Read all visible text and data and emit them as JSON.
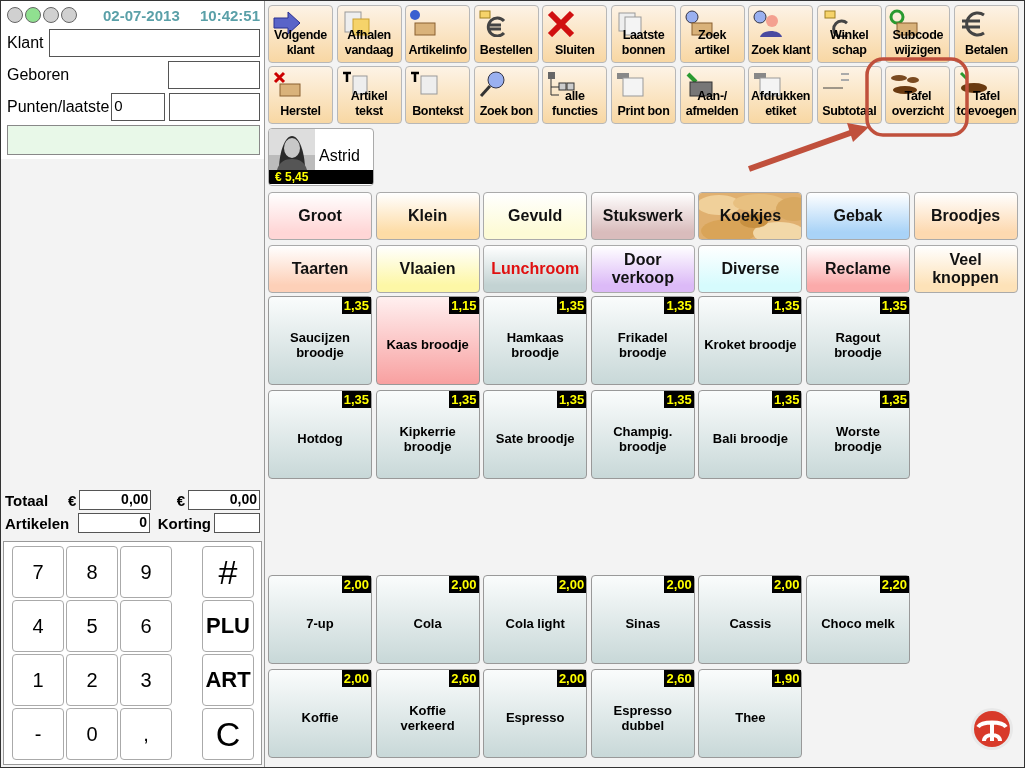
{
  "status": {
    "lights": [
      {
        "on": false
      },
      {
        "on": true
      },
      {
        "on": false
      },
      {
        "on": false
      }
    ],
    "date": "02-07-2013",
    "time": "10:42:51"
  },
  "customer": {
    "klant_label": "Klant",
    "geboren_label": "Geboren",
    "punten_label": "Punten/laatste",
    "punten_value": "0"
  },
  "totals": {
    "totaal_label": "Totaal",
    "currency_1": "€",
    "totaal_value": "0,00",
    "currency_2": "€",
    "second_value": "0,00",
    "artikelen_label": "Artikelen",
    "artikelen_value": "0",
    "korting_label": "Korting"
  },
  "numpad": [
    [
      "7",
      "8",
      "9",
      "#"
    ],
    [
      "4",
      "5",
      "6",
      "PLU"
    ],
    [
      "1",
      "2",
      "3",
      "ART"
    ],
    [
      "-",
      "0",
      ",",
      "C"
    ]
  ],
  "toolbar_rows": [
    [
      "Volgende klant",
      "Afhalen vandaag",
      "Artikelinfo",
      "Bestellen",
      "Sluiten",
      "Laatste bonnen",
      "Zoek artikel",
      "Zoek klant",
      "Winkel schap",
      "Subcode wijzigen",
      "Betalen"
    ],
    [
      "Herstel",
      "Artikel tekst",
      "Bontekst",
      "Zoek bon",
      "alle functies",
      "Print bon",
      "Aan-/ afmelden",
      "Afdrukken etiket",
      "Subtotaal",
      "Tafel overzicht",
      "Tafel toevoegen"
    ]
  ],
  "operator": {
    "name": "Astrid",
    "amount": "€ 5,45"
  },
  "categories": [
    [
      {
        "label": "Groot",
        "color": "#ffd6d6",
        "selected": false
      },
      {
        "label": "Klein",
        "color": "#fddca6",
        "selected": false
      },
      {
        "label": "Gevuld",
        "color": "#fdfbd6",
        "selected": false
      },
      {
        "label": "Stukswerk",
        "color": "#d9bcbc",
        "selected": false
      },
      {
        "label": "Koekjes",
        "kind": "picture",
        "color": "#e0b070",
        "selected": false
      },
      {
        "label": "Gebak",
        "color": "#a9d3f7",
        "selected": false
      },
      {
        "label": "Broodjes",
        "color": "#fdd9b0",
        "selected": false
      }
    ],
    [
      {
        "label": "Taarten",
        "color": "#fdd0b8",
        "selected": false
      },
      {
        "label": "Vlaaien",
        "color": "#fdf7a6",
        "selected": false
      },
      {
        "label": "Lunchroom",
        "color": "#c3d3d3",
        "selected": true
      },
      {
        "label": "Door verkoop",
        "color": "#dcbaf7",
        "selected": false
      },
      {
        "label": "Diverse",
        "color": "#d6fbfd",
        "selected": false
      },
      {
        "label": "Reclame",
        "color": "#fbaaaa",
        "selected": false
      },
      {
        "label": "Veel knoppen",
        "color": "#fde2b8",
        "selected": false
      }
    ]
  ],
  "food_products": [
    [
      {
        "name": "Saucijzen broodje",
        "price": "1,35",
        "highlighted": false
      },
      {
        "name": "Kaas broodje",
        "price": "1,15",
        "highlighted": true
      },
      {
        "name": "Hamkaas broodje",
        "price": "1,35",
        "highlighted": false
      },
      {
        "name": "Frikadel broodje",
        "price": "1,35",
        "highlighted": false
      },
      {
        "name": "Kroket broodje",
        "price": "1,35",
        "highlighted": false
      },
      {
        "name": "Ragout broodje",
        "price": "1,35",
        "highlighted": false
      }
    ],
    [
      {
        "name": "Hotdog",
        "price": "1,35",
        "highlighted": false
      },
      {
        "name": "Kipkerrie broodje",
        "price": "1,35",
        "highlighted": false
      },
      {
        "name": "Sate broodje",
        "price": "1,35",
        "highlighted": false
      },
      {
        "name": "Champig. broodje",
        "price": "1,35",
        "highlighted": false
      },
      {
        "name": "Bali broodje",
        "price": "1,35",
        "highlighted": false
      },
      {
        "name": "Worste broodje",
        "price": "1,35",
        "highlighted": false
      }
    ]
  ],
  "drink_products": [
    [
      {
        "name": "7-up",
        "price": "2,00",
        "highlighted": false
      },
      {
        "name": "Cola",
        "price": "2,00",
        "highlighted": false
      },
      {
        "name": "Cola light",
        "price": "2,00",
        "highlighted": false
      },
      {
        "name": "Sinas",
        "price": "2,00",
        "highlighted": false
      },
      {
        "name": "Cassis",
        "price": "2,00",
        "highlighted": false
      },
      {
        "name": "Choco melk",
        "price": "2,20",
        "highlighted": false
      }
    ],
    [
      {
        "name": "Koffie",
        "price": "2,00",
        "highlighted": false
      },
      {
        "name": "Koffie verkeerd",
        "price": "2,60",
        "highlighted": false
      },
      {
        "name": "Espresso",
        "price": "2,00",
        "highlighted": false
      },
      {
        "name": "Espresso dubbel",
        "price": "2,60",
        "highlighted": false
      },
      {
        "name": "Thee",
        "price": "1,90",
        "highlighted": false
      }
    ]
  ]
}
